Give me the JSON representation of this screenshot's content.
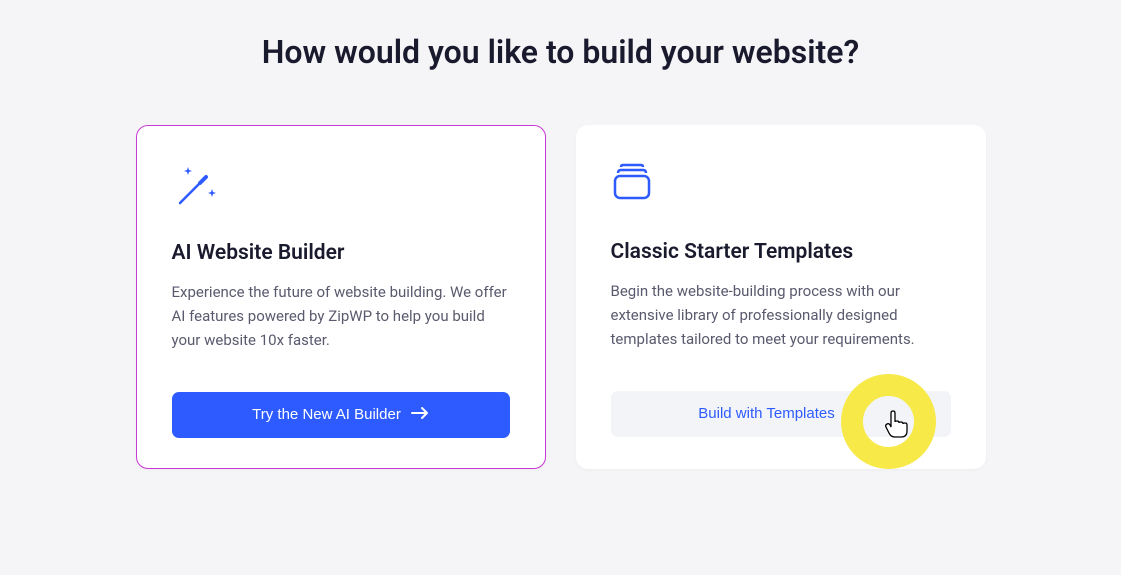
{
  "heading": "How would you like to build your website?",
  "cards": {
    "ai": {
      "title": "AI Website Builder",
      "description": "Experience the future of website building. We offer AI features powered by ZipWP to help you build your website 10x faster.",
      "button": "Try the New AI Builder"
    },
    "classic": {
      "title": "Classic Starter Templates",
      "description": "Begin the website-building process with our extensive library of professionally designed templates tailored to meet your requirements.",
      "button": "Build with Templates"
    }
  },
  "colors": {
    "accent": "#2e5bff",
    "highlight": "#f7e948",
    "selected_border": "#c939d6"
  }
}
